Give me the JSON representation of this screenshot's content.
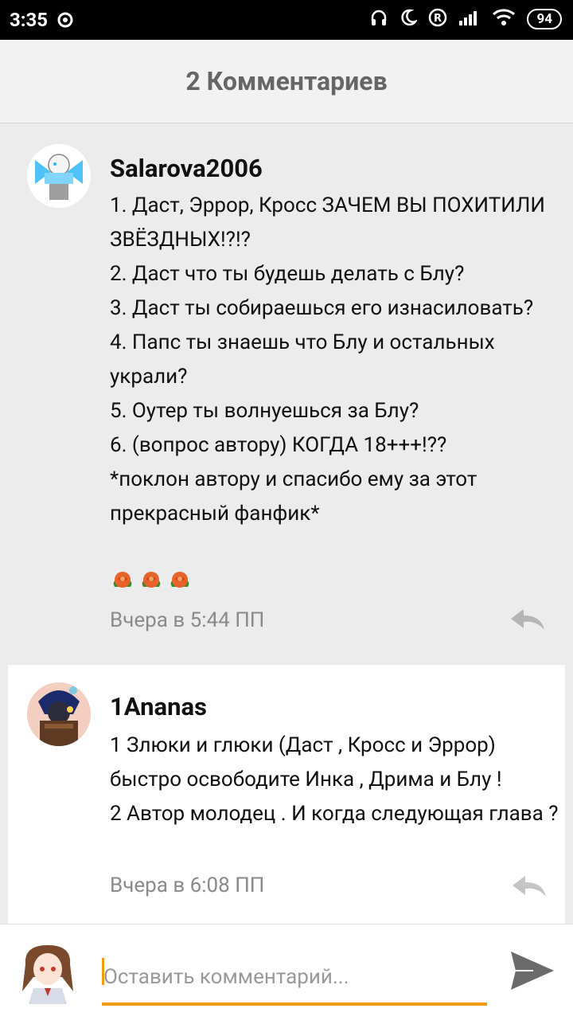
{
  "status_bar": {
    "time": "3:35",
    "battery": "94"
  },
  "header": {
    "title": "2 Комментариев"
  },
  "comments": [
    {
      "username": "Salarova2006",
      "text": "1. Даст, Эррор, Кросс ЗАЧЕМ ВЫ ПОХИТИЛИ ЗВЁЗДНЫХ!?!?\n2. Даст что ты будешь делать с Блу?\n3. Даст ты собираешься его изнасиловать?\n4. Папс ты знаешь что Блу и остальных украли?\n5. Оутер ты волнуешься за Блу?\n6. (вопрос автору) КОГДА 18+++!??\n*поклон автору и спасибо ему за этот прекрасный фанфик*",
      "emoji": "rose-emoji x3",
      "timestamp": "Вчера в 5:44 ПП"
    },
    {
      "username": "1Ananas",
      "text": "1 Злюки и глюки (Даст , Кросс и Эррор) быстро освободите Инка , Дрима и Блу !\n2 Автор молодец . И когда следующая глава ?",
      "timestamp": "Вчера в 6:08 ПП"
    }
  ],
  "composer": {
    "placeholder": "Оставить комментарий..."
  },
  "colors": {
    "accent": "#f39c12",
    "header_bg": "#f2f2f2",
    "page_bg": "#ececec"
  }
}
